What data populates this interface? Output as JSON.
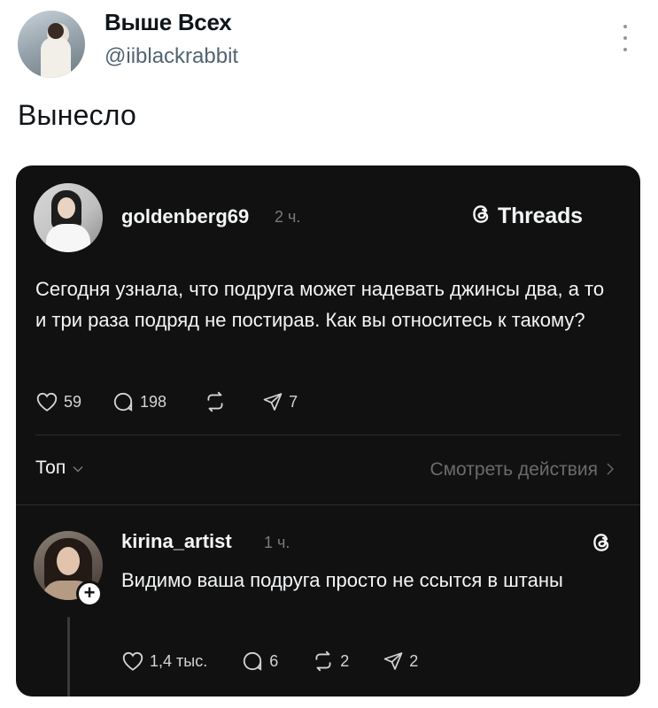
{
  "tweet": {
    "author_name": "Выше Всех",
    "author_handle": "@iiblackrabbit",
    "text": "Вынесло",
    "avatar_icon": "profile-photo",
    "more_icon": "vertical-ellipsis-icon"
  },
  "threads_post": {
    "brand_label": "Threads",
    "username": "goldenberg69",
    "time": "2 ч.",
    "text": "Сегодня узнала, что подруга может надевать джинсы два, а то и три раза подряд не постирав. Как вы относитесь к такому?",
    "actions": {
      "likes": "59",
      "comments": "198",
      "shares": "7"
    },
    "sort_label": "Топ",
    "view_activity_label": "Смотреть действия"
  },
  "reply": {
    "username": "kirina_artist",
    "time": "1 ч.",
    "text": "Видимо ваша подруга просто не ссытся в штаны",
    "actions": {
      "likes": "1,4 тыс.",
      "comments": "6",
      "reposts": "2",
      "shares": "2"
    }
  },
  "colors": {
    "card_background": "#111111",
    "text_primary": "#f3f5f7",
    "text_muted": "#7a7a7a",
    "handle_gray": "#536471"
  }
}
